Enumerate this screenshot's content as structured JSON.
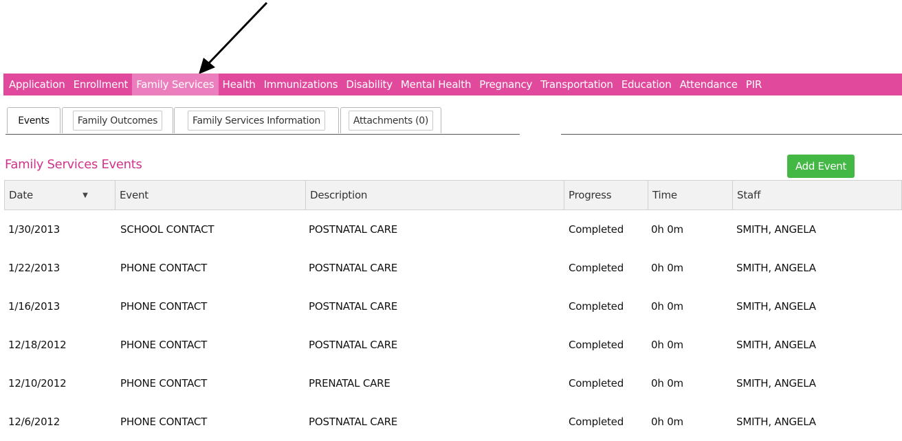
{
  "nav": {
    "items": [
      {
        "label": "Application",
        "active": false
      },
      {
        "label": "Enrollment",
        "active": false
      },
      {
        "label": "Family Services",
        "active": true
      },
      {
        "label": "Health",
        "active": false
      },
      {
        "label": "Immunizations",
        "active": false
      },
      {
        "label": "Disability",
        "active": false
      },
      {
        "label": "Mental Health",
        "active": false
      },
      {
        "label": "Pregnancy",
        "active": false
      },
      {
        "label": "Transportation",
        "active": false
      },
      {
        "label": "Education",
        "active": false
      },
      {
        "label": "Attendance",
        "active": false
      },
      {
        "label": "PIR",
        "active": false
      }
    ],
    "bg_color": "#e0499c",
    "active_color": "#eb7fbd"
  },
  "tabs": [
    {
      "label": "Events",
      "active": true
    },
    {
      "label": "Family Outcomes",
      "active": false
    },
    {
      "label": "Family Services Information",
      "active": false
    },
    {
      "label": "Attachments (0)",
      "active": false
    }
  ],
  "section": {
    "title": "Family Services Events",
    "add_button": "Add Event"
  },
  "table": {
    "columns": [
      "Date",
      "Event",
      "Description",
      "Progress",
      "Time",
      "Staff"
    ],
    "sort_icon": "caret-down-icon",
    "rows": [
      [
        "1/30/2013",
        "SCHOOL CONTACT",
        "POSTNATAL CARE",
        "Completed",
        "0h 0m",
        "SMITH, ANGELA"
      ],
      [
        "1/22/2013",
        "PHONE CONTACT",
        "POSTNATAL CARE",
        "Completed",
        "0h 0m",
        "SMITH, ANGELA"
      ],
      [
        "1/16/2013",
        "PHONE CONTACT",
        "POSTNATAL CARE",
        "Completed",
        "0h 0m",
        "SMITH, ANGELA"
      ],
      [
        "12/18/2012",
        "PHONE CONTACT",
        "POSTNATAL CARE",
        "Completed",
        "0h 0m",
        "SMITH, ANGELA"
      ],
      [
        "12/10/2012",
        "PHONE CONTACT",
        "PRENATAL CARE",
        "Completed",
        "0h 0m",
        "SMITH, ANGELA"
      ],
      [
        "12/6/2012",
        "PHONE CONTACT",
        "POSTNATAL CARE",
        "Completed",
        "0h 0m",
        "SMITH, ANGELA"
      ]
    ]
  },
  "colors": {
    "title": "#d0338a",
    "add_button": "#44b844"
  }
}
